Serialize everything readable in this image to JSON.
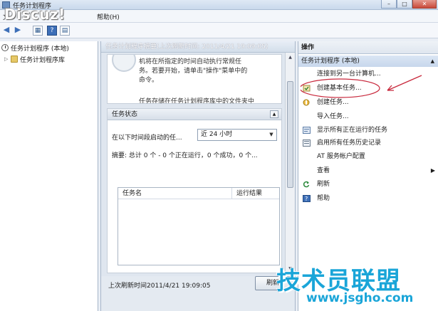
{
  "window": {
    "title": "任务计划程序",
    "minimize": "–",
    "maximize": "□",
    "close": "✕"
  },
  "watermark_top": "Discuz!",
  "menu": {
    "file_prefix": "文",
    "help": "帮助(H)"
  },
  "left_pane": {
    "items": [
      {
        "label": "任务计划程序 (本地)"
      },
      {
        "label": "任务计划程序库"
      }
    ]
  },
  "middle_pane": {
    "header": "任务计划程序摘要(上次刷新时间: 2011/4/21 19:09:05)",
    "description_lines": [
      "机将在所指定的时间自动执行常规任",
      "务。若要开始，请单击\"操作\"菜单中的",
      "命令。"
    ],
    "description_cut": "任务存储在任务计划程序库中的文件夹中",
    "status_section": {
      "title": "任务状态",
      "range_label": "在以下时间段启动的任...",
      "range_value": "近 24 小时",
      "summary": "摘要: 总计 0 个 - 0 个正在运行，0 个成功，0 个...",
      "columns": [
        "任务名",
        "运行结果"
      ]
    },
    "footer": {
      "last_refresh": "上次刷新时间2011/4/21 19:09:05",
      "refresh_button": "刷新"
    }
  },
  "right_pane": {
    "title": "操作",
    "group": "任务计划程序 (本地)",
    "actions": [
      {
        "label": "连接到另一台计算机...",
        "icon": "computer-icon"
      },
      {
        "label": "创建基本任务...",
        "icon": "basic-task-icon"
      },
      {
        "label": "创建任务...",
        "icon": "create-task-icon"
      },
      {
        "label": "导入任务...",
        "icon": "none"
      },
      {
        "label": "显示所有正在运行的任务",
        "icon": "running-tasks-icon"
      },
      {
        "label": "启用所有任务历史记录",
        "icon": "history-icon"
      },
      {
        "label": "AT 服务帐户配置",
        "icon": "none"
      },
      {
        "label": "查看",
        "icon": "none"
      },
      {
        "label": "刷新",
        "icon": "refresh-icon"
      },
      {
        "label": "帮助",
        "icon": "help-icon"
      }
    ]
  },
  "watermark": {
    "brand": "技术员联盟",
    "url": "www.jsgho.com"
  },
  "colors": {
    "accent": "#3d6fb8",
    "watermark": "#1aa5d8",
    "annotation": "#c8283c"
  }
}
